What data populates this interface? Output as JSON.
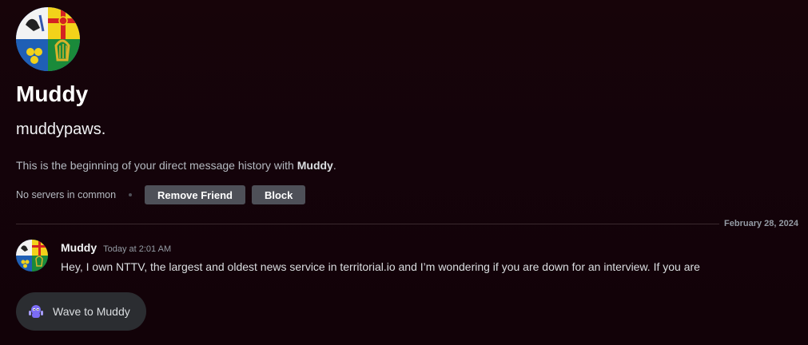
{
  "profile": {
    "display_name": "Muddy",
    "username": "muddypaws.",
    "intro_prefix": "This is the beginning of your direct message history with ",
    "intro_name": "Muddy",
    "intro_suffix": "."
  },
  "actions": {
    "mutual_servers": "No servers in common",
    "remove_friend_label": "Remove Friend",
    "block_label": "Block"
  },
  "divider": {
    "date": "February 28, 2024"
  },
  "message": {
    "author": "Muddy",
    "timestamp": "Today at 2:01 AM",
    "content": "Hey, I own NTTV, the largest and oldest news service in territorial.io and I’m wondering if you are down for an interview. If you are"
  },
  "wave": {
    "label": "Wave to Muddy",
    "icon": "wumpus-wave-icon"
  },
  "colors": {
    "background": "#150308",
    "button": "#4e5058",
    "wave_button": "#2b2d31",
    "text_primary": "#ffffff",
    "text_muted": "#b5bac1"
  }
}
